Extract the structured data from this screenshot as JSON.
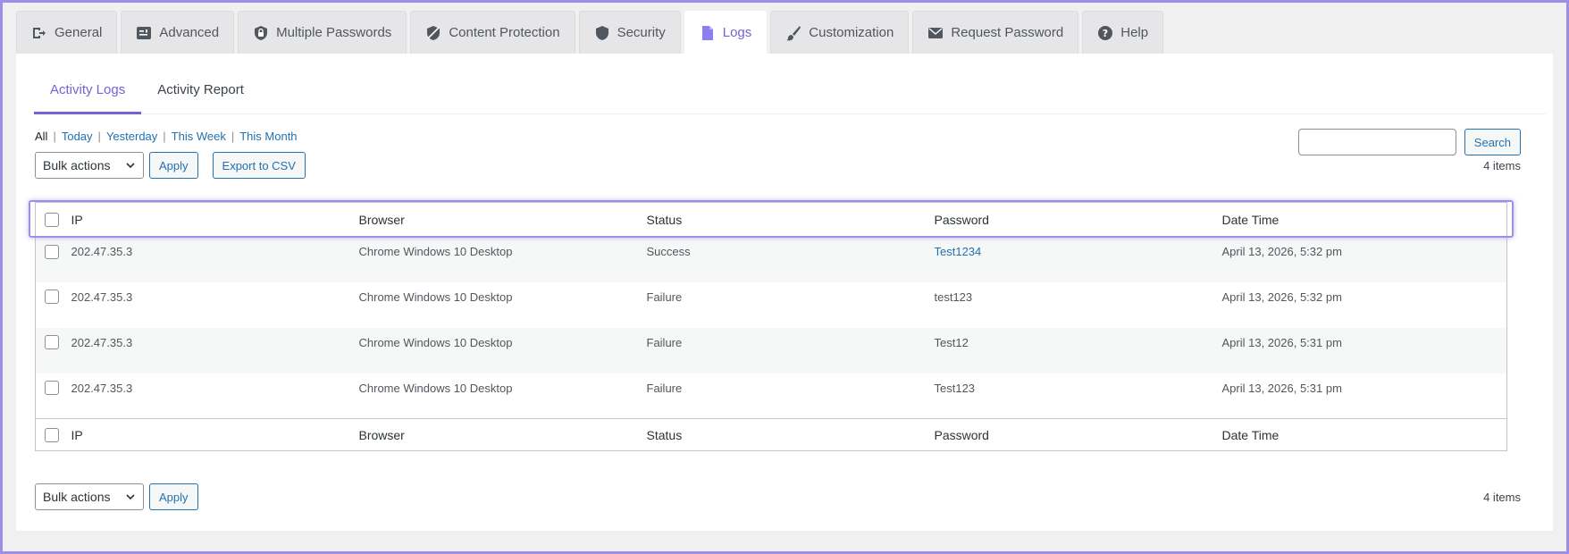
{
  "tabs": [
    {
      "label": "General",
      "icon": "sign-in-icon"
    },
    {
      "label": "Advanced",
      "icon": "sliders-icon"
    },
    {
      "label": "Multiple Passwords",
      "icon": "shield-lock-icon"
    },
    {
      "label": "Content Protection",
      "icon": "shield-slash-icon"
    },
    {
      "label": "Security",
      "icon": "shield-icon"
    },
    {
      "label": "Logs",
      "icon": "document-icon",
      "active": true
    },
    {
      "label": "Customization",
      "icon": "brush-icon"
    },
    {
      "label": "Request Password",
      "icon": "envelope-icon"
    },
    {
      "label": "Help",
      "icon": "question-icon"
    }
  ],
  "subtabs": [
    {
      "label": "Activity Logs",
      "active": true
    },
    {
      "label": "Activity Report"
    }
  ],
  "filters": {
    "all": "All",
    "today": "Today",
    "yesterday": "Yesterday",
    "this_week": "This Week",
    "this_month": "This Month",
    "separator": "|"
  },
  "search": {
    "button": "Search",
    "value": ""
  },
  "toolbar": {
    "bulk_actions": "Bulk actions",
    "apply": "Apply",
    "export": "Export to CSV",
    "count": "4 items"
  },
  "table": {
    "columns": [
      "IP",
      "Browser",
      "Status",
      "Password",
      "Date Time"
    ],
    "rows": [
      {
        "ip": "202.47.35.3",
        "browser": "Chrome Windows 10 Desktop",
        "status": "Success",
        "password": "Test1234",
        "datetime": "April 13, 2026, 5:32 pm"
      },
      {
        "ip": "202.47.35.3",
        "browser": "Chrome Windows 10 Desktop",
        "status": "Failure",
        "password": "test123",
        "datetime": "April 13, 2026, 5:32 pm"
      },
      {
        "ip": "202.47.35.3",
        "browser": "Chrome Windows 10 Desktop",
        "status": "Failure",
        "password": "Test12",
        "datetime": "April 13, 2026, 5:31 pm"
      },
      {
        "ip": "202.47.35.3",
        "browser": "Chrome Windows 10 Desktop",
        "status": "Failure",
        "password": "Test123",
        "datetime": "April 13, 2026, 5:31 pm"
      }
    ]
  },
  "colors": {
    "accent": "#7263d9",
    "link": "#2271b1",
    "highlight": "#9b8fe6"
  }
}
